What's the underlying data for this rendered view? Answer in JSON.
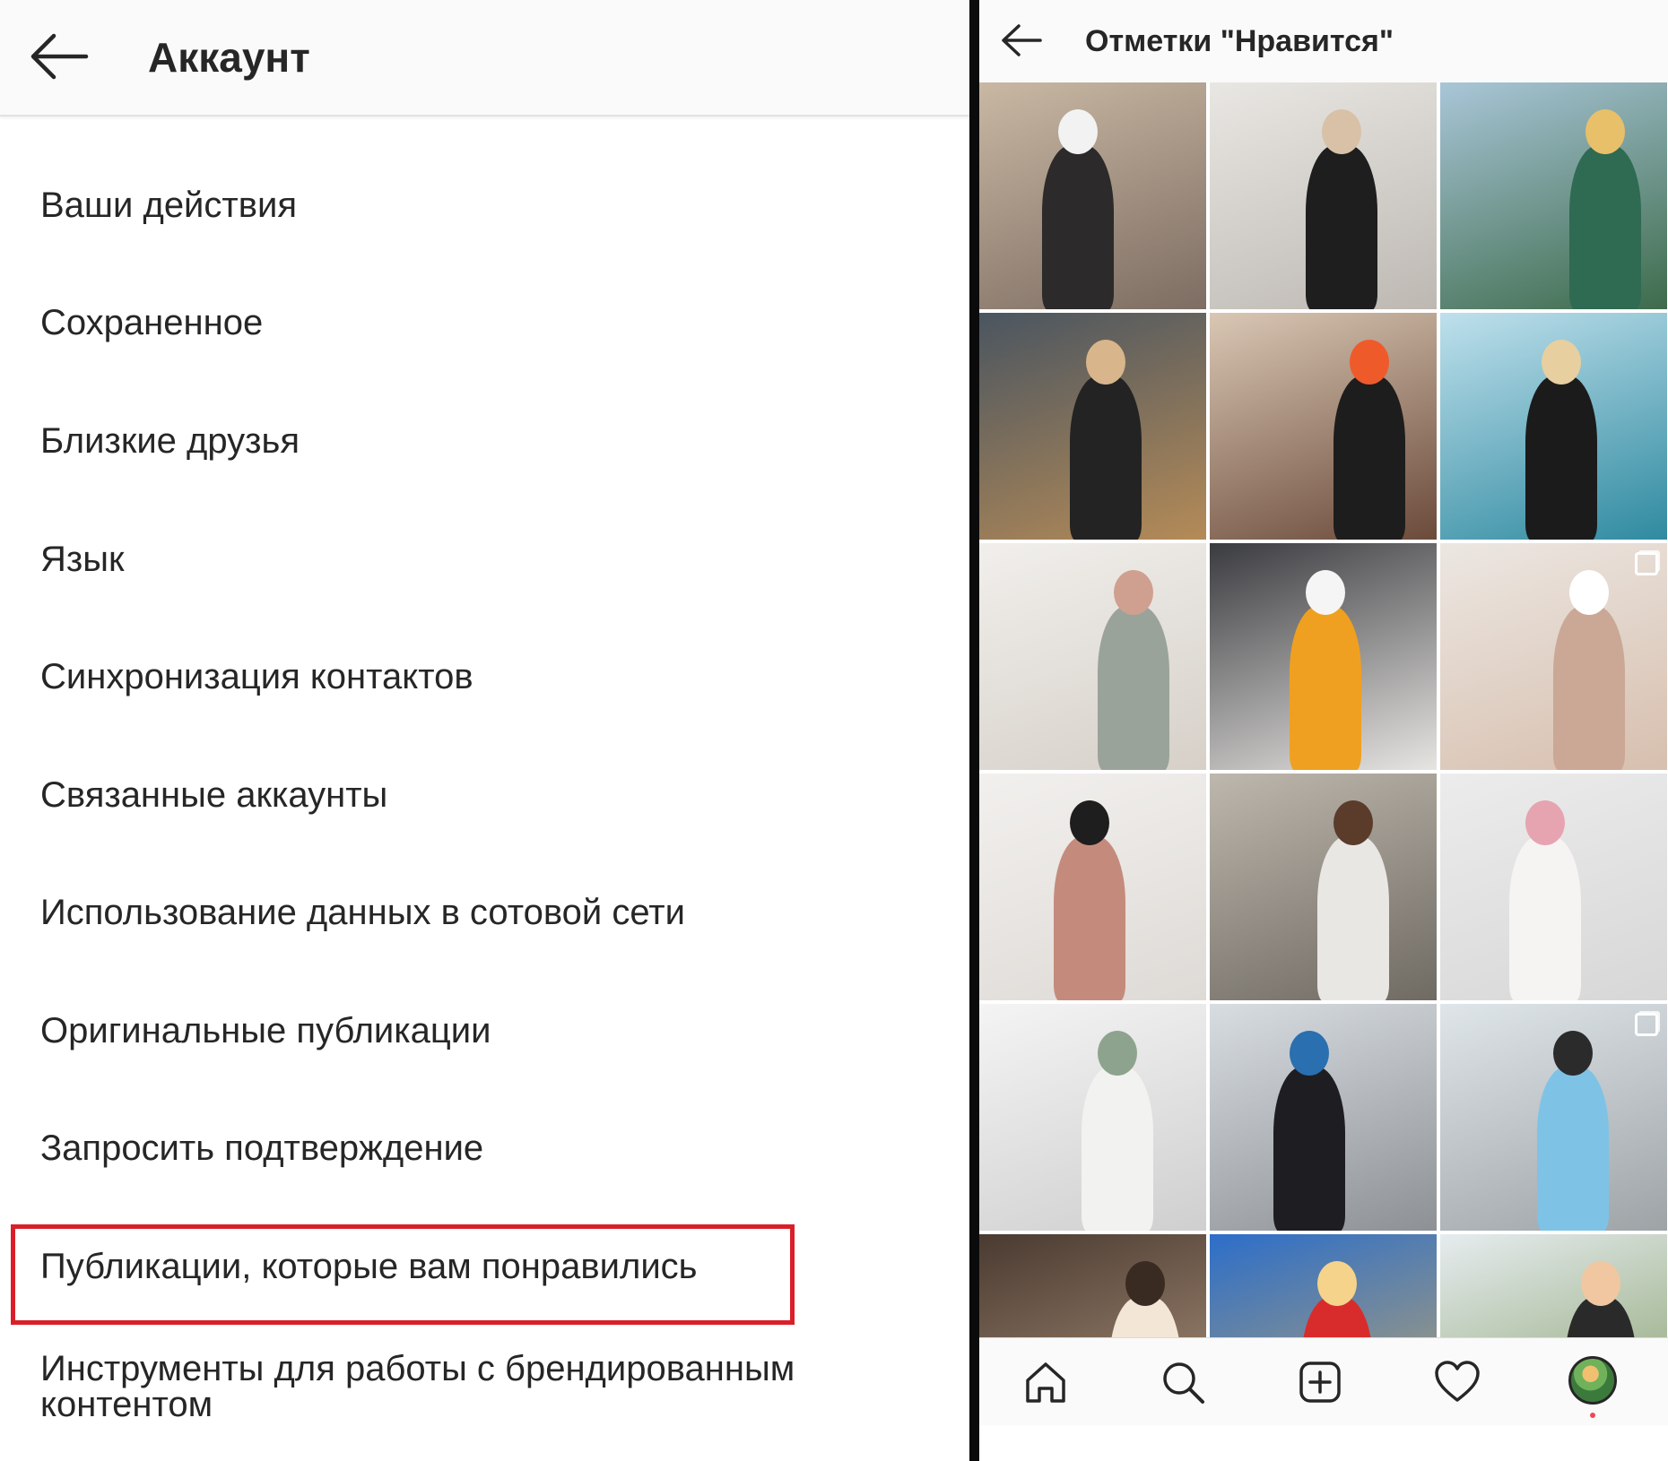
{
  "left": {
    "title": "Аккаунт",
    "menu": [
      "Ваши действия",
      "Сохраненное",
      "Близкие друзья",
      "Язык",
      "Синхронизация контактов",
      "Связанные аккаунты",
      "Использование данных в сотовой сети",
      "Оригинальные публикации",
      "Запросить подтверждение",
      "Публикации, которые вам понравились",
      "Инструменты для работы с брендированным контентом"
    ],
    "highlighted_item": "Публикации, которые вам понравились",
    "highlight_color": "#d9202a"
  },
  "right": {
    "title": "Отметки \"Нравится\"",
    "grid_columns": 3,
    "tiles": [
      {
        "bg": [
          "#c9b8a3",
          "#7d6d62"
        ],
        "figure": "#2c2a2a",
        "accent": "#f2f2f2",
        "multi": false
      },
      {
        "bg": [
          "#e9e7e3",
          "#bdb8b2"
        ],
        "figure": "#1f1e1e",
        "accent": "#d8c1a6",
        "multi": false
      },
      {
        "bg": [
          "#a9c6d8",
          "#3d6b4b"
        ],
        "figure": "#2f6a52",
        "accent": "#e8c06a",
        "multi": false
      },
      {
        "bg": [
          "#4a5560",
          "#b58b57"
        ],
        "figure": "#232323",
        "accent": "#d9b58c",
        "multi": false
      },
      {
        "bg": [
          "#d9c7b4",
          "#6b4a3a"
        ],
        "figure": "#1d1d1d",
        "accent": "#ef5a2b",
        "multi": false
      },
      {
        "bg": [
          "#bfe0ec",
          "#2f8aa0"
        ],
        "figure": "#1b1b1b",
        "accent": "#e7cfa0",
        "multi": false
      },
      {
        "bg": [
          "#f1efec",
          "#d6d0c8"
        ],
        "figure": "#9aa39a",
        "accent": "#cfa08f",
        "multi": false
      },
      {
        "bg": [
          "#3a3b3f",
          "#e7e5e2"
        ],
        "figure": "#f0a020",
        "accent": "#f5f5f5",
        "multi": false
      },
      {
        "bg": [
          "#ece7e2",
          "#d7bfae"
        ],
        "figure": "#caa895",
        "accent": "#ffffff",
        "multi": true
      },
      {
        "bg": [
          "#f2f0ee",
          "#dedad6"
        ],
        "figure": "#c48b7d",
        "accent": "#1e1e1e",
        "multi": false
      },
      {
        "bg": [
          "#bdb7ad",
          "#6f6a62"
        ],
        "figure": "#e9e7e4",
        "accent": "#5b3b2a",
        "multi": false
      },
      {
        "bg": [
          "#ececec",
          "#d7d7d7"
        ],
        "figure": "#f6f3f3",
        "accent": "#e5a4b0",
        "multi": false
      },
      {
        "bg": [
          "#f4f4f4",
          "#cfcfcf"
        ],
        "figure": "#f2f2f0",
        "accent": "#8da38d",
        "multi": false
      },
      {
        "bg": [
          "#d8dde2",
          "#8d9196"
        ],
        "figure": "#1e1e22",
        "accent": "#2a6fb0",
        "multi": false
      },
      {
        "bg": [
          "#dfe6ea",
          "#9ea3a6"
        ],
        "figure": "#7ec3e6",
        "accent": "#2b2b2b",
        "multi": true
      },
      {
        "bg": [
          "#4a3a30",
          "#b39982"
        ],
        "figure": "#f3e6d6",
        "accent": "#3a2b22",
        "multi": false
      },
      {
        "bg": [
          "#2c6ec9",
          "#c4a86a"
        ],
        "figure": "#d82c2c",
        "accent": "#f5d38a",
        "multi": false
      },
      {
        "bg": [
          "#e6ecef",
          "#7f9a62"
        ],
        "figure": "#2a2a2a",
        "accent": "#f0c7a0",
        "multi": false
      }
    ]
  },
  "tabbar": {
    "items": [
      "home-icon",
      "search-icon",
      "add-post-icon",
      "heart-icon",
      "profile-avatar"
    ]
  }
}
